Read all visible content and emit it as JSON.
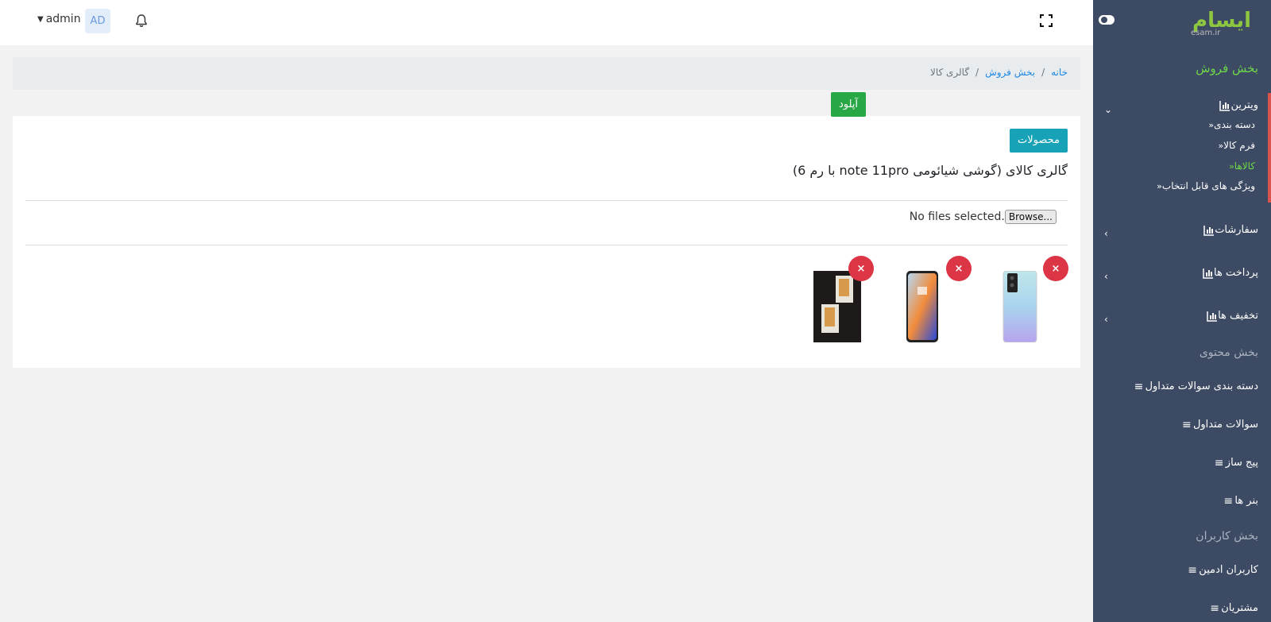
{
  "header": {
    "user_label": "admin",
    "avatar_initials": "AD"
  },
  "breadcrumb": {
    "home": "خانه",
    "sales": "بخش فروش",
    "current": "گالری کالا"
  },
  "card": {
    "products_button": "محصولات",
    "title": "گالری کالای (گوشی شیائومی note 11pro با رم 6)",
    "browse_label": "Browse...",
    "no_files_text": "No files selected.",
    "upload_label": "آپلود",
    "delete_symbol": "×"
  },
  "sidebar": {
    "logo_text": "ایسام",
    "logo_sub": "esam.ir",
    "sales_section": "بخش فروش",
    "showcase": "ویترین",
    "sub_items": [
      "دسته بندی",
      "فرم کالا",
      "کالاها",
      "ویژگی های قابل انتخاب"
    ],
    "active_sub": "کالاها",
    "orders": "سفارشات",
    "payments": "پرداخت ها",
    "discounts": "تخفیف ها",
    "content_section": "بخش محتوی",
    "faq_categories": "دسته بندی سوالات متداول",
    "faq": "سوالات متداول",
    "page_builder": "پیج ساز",
    "banners": "بنر ها",
    "users_section": "بخش کاربران",
    "admin_users": "کاربران ادمین",
    "customers": "مشتریان"
  },
  "colors": {
    "sidebar_bg": "#3c4a63",
    "accent_green": "#6ed84a",
    "accent_red": "#d9534f",
    "info": "#17a2b8",
    "success": "#28a745",
    "danger": "#dc3545"
  }
}
